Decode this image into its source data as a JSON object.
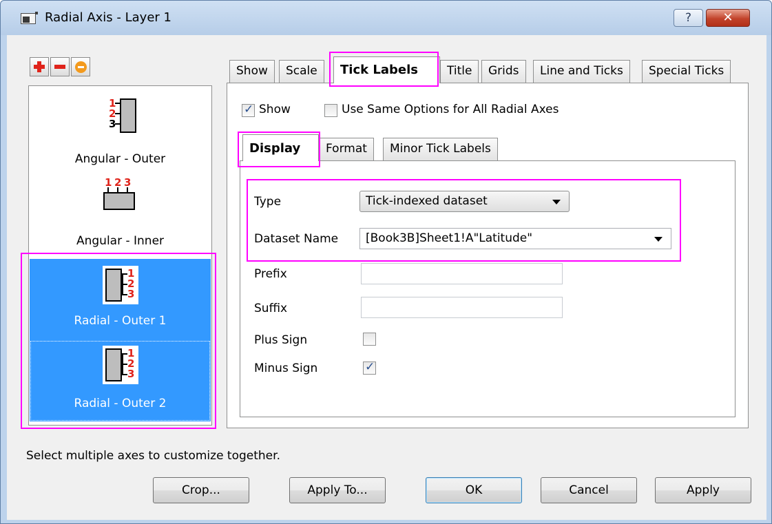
{
  "window": {
    "title": "Radial Axis - Layer 1",
    "help_label": "?",
    "close_label": "✕"
  },
  "toolbar": {
    "add_icon": "plus-icon",
    "remove_icon": "minus-icon",
    "option_icon": "circle-icon"
  },
  "axis_list": {
    "items": [
      {
        "label": "Angular - Outer",
        "icon": "angular-outer-icon",
        "selected": false,
        "ticks": [
          "1",
          "2",
          "3"
        ]
      },
      {
        "label": "Angular - Inner",
        "icon": "angular-inner-icon",
        "selected": false,
        "ticks": [
          "1",
          "2",
          "3"
        ]
      },
      {
        "label": "Radial - Outer 1",
        "icon": "radial-outer-icon",
        "selected": true,
        "ticks": [
          "1",
          "2",
          "3"
        ]
      },
      {
        "label": "Radial - Outer 2",
        "icon": "radial-outer-icon",
        "selected": true,
        "ticks": [
          "1",
          "2",
          "3"
        ]
      }
    ]
  },
  "tabs": [
    {
      "label": "Show",
      "active": false
    },
    {
      "label": "Scale",
      "active": false
    },
    {
      "label": "Tick Labels",
      "active": true
    },
    {
      "label": "Title",
      "active": false
    },
    {
      "label": "Grids",
      "active": false
    },
    {
      "label": "Line and Ticks",
      "active": false
    },
    {
      "label": "Special Ticks",
      "active": false
    }
  ],
  "tick_labels": {
    "show_label": "Show",
    "show_checked": true,
    "same_options_label": "Use Same Options for All Radial Axes",
    "same_options_checked": false,
    "subtabs": [
      {
        "label": "Display",
        "active": true
      },
      {
        "label": "Format",
        "active": false
      },
      {
        "label": "Minor Tick Labels",
        "active": false
      }
    ],
    "display": {
      "type_label": "Type",
      "type_value": "Tick-indexed dataset",
      "dataset_label": "Dataset Name",
      "dataset_value": "[Book3B]Sheet1!A\"Latitude\"",
      "prefix_label": "Prefix",
      "prefix_value": "",
      "suffix_label": "Suffix",
      "suffix_value": "",
      "plus_sign_label": "Plus Sign",
      "plus_sign_checked": false,
      "minus_sign_label": "Minus Sign",
      "minus_sign_checked": true
    }
  },
  "status_text": "Select multiple axes to customize together.",
  "buttons": {
    "crop": "Crop...",
    "apply_to": "Apply To...",
    "ok": "OK",
    "cancel": "Cancel",
    "apply": "Apply"
  },
  "colors": {
    "highlight": "#ff00ff",
    "selection": "#3399ff",
    "tick_number": "#e0241b"
  }
}
